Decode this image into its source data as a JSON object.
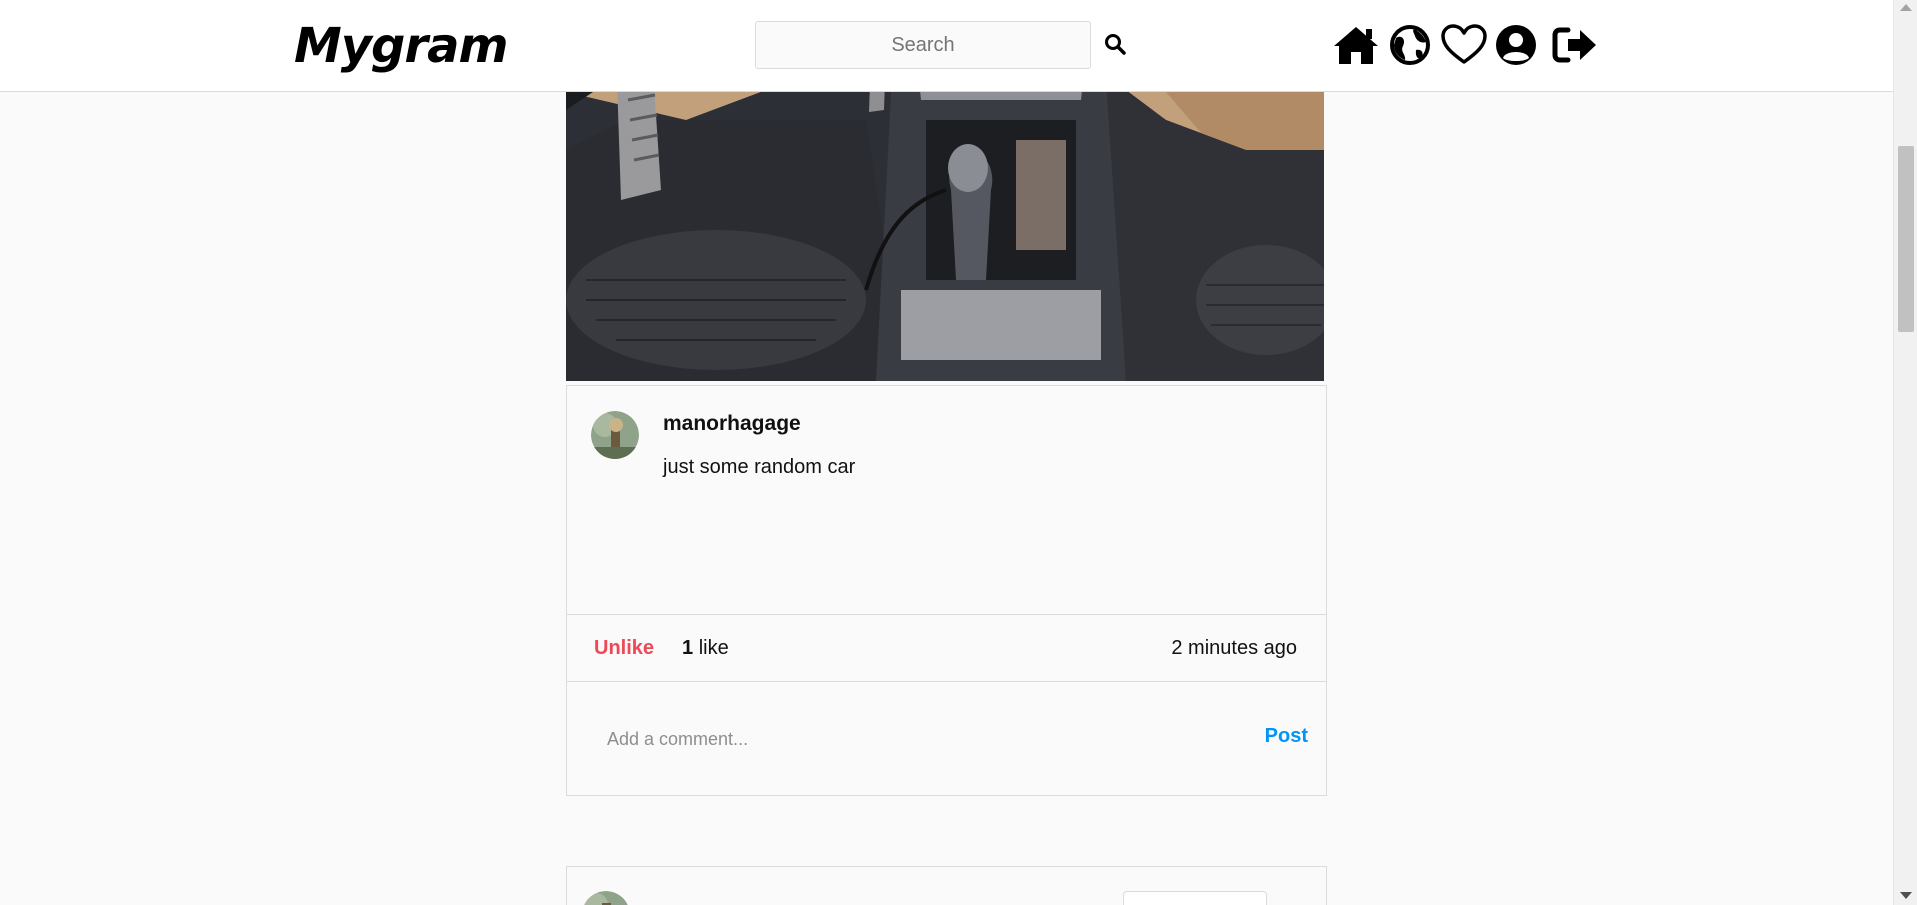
{
  "header": {
    "logo": "Mygram",
    "search_placeholder": "Search",
    "nav_icons": [
      "home-icon",
      "explore-globe-icon",
      "activity-heart-icon",
      "profile-icon",
      "logout-icon"
    ]
  },
  "post": {
    "image_description": "car interior center console photo",
    "username": "manorhagage",
    "caption": "just some random car",
    "unlike_label": "Unlike",
    "like_count": "1",
    "like_word": "like",
    "time_ago": "2 minutes ago",
    "comment_placeholder": "Add a comment...",
    "post_label": "Post"
  },
  "colors": {
    "unlike": "#ed4956",
    "post": "#0095f6",
    "background": "#fafafa",
    "border": "#dbdbdb"
  }
}
